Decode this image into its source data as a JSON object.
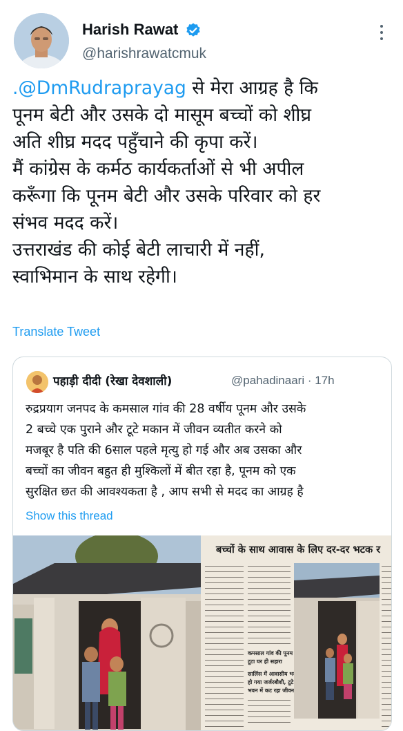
{
  "author": {
    "name": "Harish Rawat",
    "handle": "@harishrawatcmuk"
  },
  "tweet": {
    "mention": ".@DmRudraprayag",
    "lines": [
      " से मेरा आग्रह है कि",
      "पूनम बेटी और उसके दो मासूम बच्चों को शीघ्र",
      "अति शीघ्र मदद पहुँचाने की कृपा करें।",
      "मैं कांग्रेस के कर्मठ कार्यकर्ताओं से भी अपील",
      "करूँगा कि पूनम बेटी और उसके परिवार को हर",
      "संभव मदद करें।",
      "उत्तराखंड की कोई बेटी लाचारी में नहीं,",
      "स्वाभिमान के साथ रहेगी।"
    ],
    "translate_label": "Translate Tweet"
  },
  "quote": {
    "name": "पहाड़ी दीदी (रेखा देवशाली)",
    "handle": "@pahadinaari · 17h",
    "lines": [
      "रुद्रप्रयाग जनपद के कमसाल गांव की 28 वर्षीय पूनम और उसके",
      "2 बच्चे एक पुराने और टूटे मकान में जीवन व्यतीत करने को",
      "मजबूर है पति की 6साल पहले मृत्यु हो गई और अब उसका और",
      "बच्चों  का जीवन बहुत ही मुश्किलों में बीत रहा है, पूनम को एक",
      "सुरक्षित छत की आवश्यकता है , आप सभी से मदद का आग्रह है"
    ],
    "show_thread": "Show this thread",
    "newspaper": {
      "headline": "बच्चों के साथ आवास के लिए दर-दर भटक र",
      "subheads": [
        "कमसाल गांव की पूनम का",
        "टूटा घर ही सहारा",
        "सालिंस में आवासीय भवन",
        "हो गया जर्जरबौशी, टूटे",
        "भवन में कट रहा जीवन"
      ]
    }
  },
  "colors": {
    "link": "#1d9bf0",
    "secondary_text": "#536471",
    "border": "#cfd9de"
  },
  "icons": [
    "verified-badge-icon",
    "more-options-icon"
  ]
}
